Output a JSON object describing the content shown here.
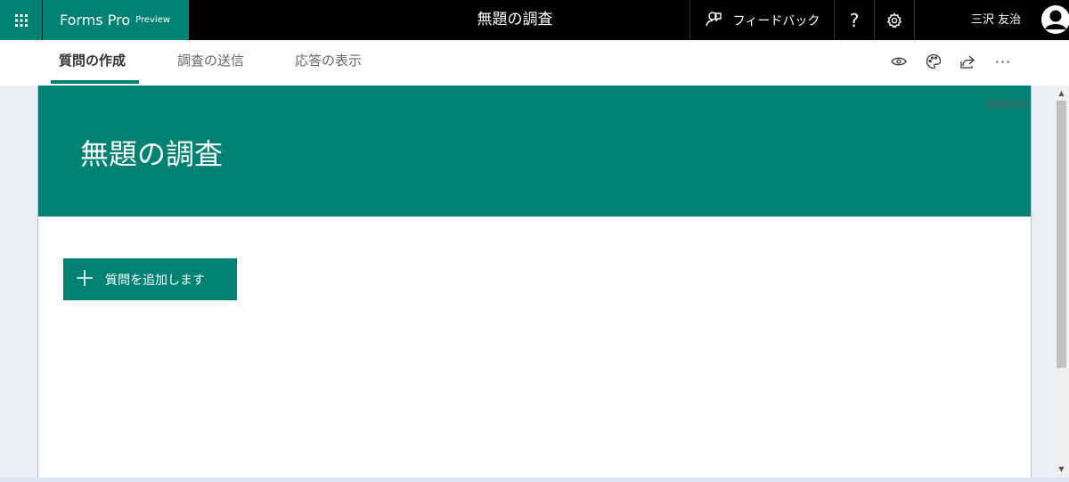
{
  "app": {
    "brand_name": "Forms Pro",
    "brand_tag": "Preview",
    "title": "無題の調査",
    "feedback_label": "フィードバック",
    "help_symbol": "?",
    "user_name": "三沢 友治"
  },
  "nav": {
    "tabs": [
      {
        "label": "質問の作成",
        "active": true
      },
      {
        "label": "調査の送信",
        "active": false
      },
      {
        "label": "応答の表示",
        "active": false
      }
    ],
    "more_symbol": "···"
  },
  "form": {
    "status": "保存済み",
    "title": "無題の調査",
    "add_question_label": "質問を追加します"
  },
  "colors": {
    "accent": "#008272",
    "topbar": "#000000"
  },
  "icons": [
    "waffle-icon",
    "feedback-icon",
    "help-icon",
    "gear-icon",
    "avatar",
    "eye-icon",
    "palette-icon",
    "share-icon",
    "more-icon",
    "plus-icon"
  ]
}
